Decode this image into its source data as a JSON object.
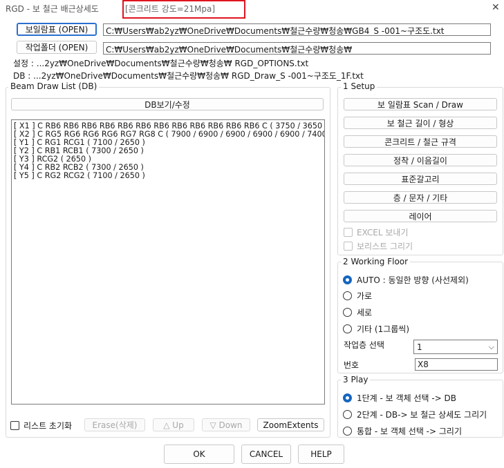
{
  "window": {
    "title": "RGD - 보 철근 배근상세도",
    "strength_label": "[콘크리트 강도=21Mpa]"
  },
  "files": {
    "beam_table_button": "보일람표 (OPEN)",
    "beam_table_path": "C:₩Users₩ab2yz₩OneDrive₩Documents₩철근수량₩청송₩GB4_S -001~구조도.txt",
    "work_folder_button": "작업폴더 (OPEN)",
    "work_folder_path": "C:₩Users₩ab2yz₩OneDrive₩Documents₩철근수량₩청송₩",
    "settings_line": "설정 : ...2yz₩OneDrive₩Documents₩철근수량₩청송₩ RGD_OPTIONS.txt",
    "db_line": "DB : ...2yz₩OneDrive₩Documents₩철근수량₩청송₩ RGD_Draw_S -001~구조도_1F.txt"
  },
  "beam_list": {
    "label": "Beam Draw List (DB)",
    "view_edit_button": "DB보기/수정",
    "items": [
      "[ X1 ] C RB6 RB6 RB6 RB6 RB6 RB6 RB6 RB6 RB6 RB6 RB6 RB6 C ( 3750 / 3650",
      "[ X2 ] C RG5 RG6 RG6 RG6 RG7 RG8 C ( 7900 / 6900 / 6900 / 6900 / 6900 / 7400",
      "[ Y1 ] C RG1 RCG1 ( 7100 / 2650 )",
      "[ Y2 ] C RB1 RCB1 ( 7300 / 2650 )",
      "[ Y3 ] RCG2 ( 2650 )",
      "[ Y4 ] C RB2 RCB2 ( 7300 / 2650 )",
      "[ Y5 ] C RG2 RCG2 ( 7100 / 2650 )"
    ],
    "reset_checkbox": "리스트 초기화",
    "erase_button": "Erase(삭제)",
    "up_button": "△ Up",
    "down_button": "▽ Down",
    "zoom_button": "ZoomExtents"
  },
  "setup": {
    "label": "1 Setup",
    "buttons": [
      "보 일람표 Scan / Draw",
      "보 철근 길이 / 형상",
      "콘크리트 / 철근 규격",
      "정착 / 이음길이",
      "표준갈고리",
      "층 / 문자 / 기타",
      "레이어"
    ],
    "excel_checkbox": "EXCEL 보내기",
    "list_draw_checkbox": "보리스트 그리기"
  },
  "working_floor": {
    "label": "2 Working  Floor",
    "options": [
      "AUTO : 동일한 방향 (사선제외)",
      "가로",
      "세로",
      "기타 (1그룹씩)"
    ],
    "selected_index": 0,
    "floor_select_label": "작업층 선택",
    "floor_select_value": "1",
    "number_label": "번호",
    "number_value": "X8"
  },
  "play": {
    "label": "3 Play",
    "options": [
      "1단계 - 보 객체 선택 -> DB",
      "2단계 - DB-> 보 철근 상세도 그리기",
      "통합  - 보 객체 선택 -> 그리기"
    ],
    "selected_index": 0
  },
  "footer": {
    "ok": "OK",
    "cancel": "CANCEL",
    "help": "HELP"
  },
  "colors": {
    "accent": "#1565c0",
    "highlight_box": "#e0141e"
  }
}
